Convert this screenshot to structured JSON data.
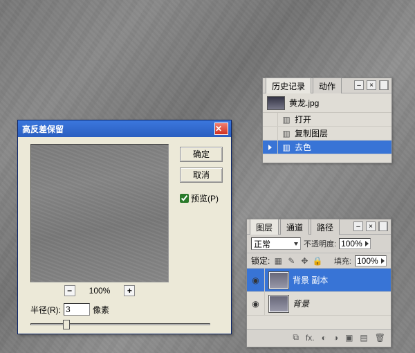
{
  "dialog": {
    "title": "高反差保留",
    "ok_label": "确定",
    "cancel_label": "取消",
    "preview_label": "预览(P)",
    "zoom_percent": "100%",
    "radius_label": "半径(R):",
    "radius_value": "3",
    "radius_unit": "像素"
  },
  "history": {
    "tabs": [
      "历史记录",
      "动作"
    ],
    "active_tab": 0,
    "snapshot": "黄龙.jpg",
    "steps": [
      {
        "icon": "document-icon",
        "label": "打开"
      },
      {
        "icon": "layers-icon",
        "label": "复制图层"
      },
      {
        "icon": "adjust-icon",
        "label": "去色"
      }
    ],
    "selected_step": 2
  },
  "layers": {
    "tabs": [
      "图层",
      "通道",
      "路径"
    ],
    "active_tab": 0,
    "blend_mode": "正常",
    "opacity_label": "不透明度:",
    "opacity_value": "100%",
    "lock_label": "锁定:",
    "fill_label": "填充:",
    "fill_value": "100%",
    "rows": [
      {
        "name": "背景 副本",
        "selected": true,
        "bg": false
      },
      {
        "name": "背景",
        "selected": false,
        "bg": true
      }
    ]
  },
  "icons": {
    "minus": "−",
    "plus": "+",
    "close": "✕",
    "eye": "◉",
    "chevron": "▾",
    "chevron_r": "▸",
    "link": "⧉",
    "fx": "fx.",
    "mask": "◐",
    "folder": "▣",
    "adjust": "◑",
    "new": "▤",
    "trash": "🗑"
  }
}
